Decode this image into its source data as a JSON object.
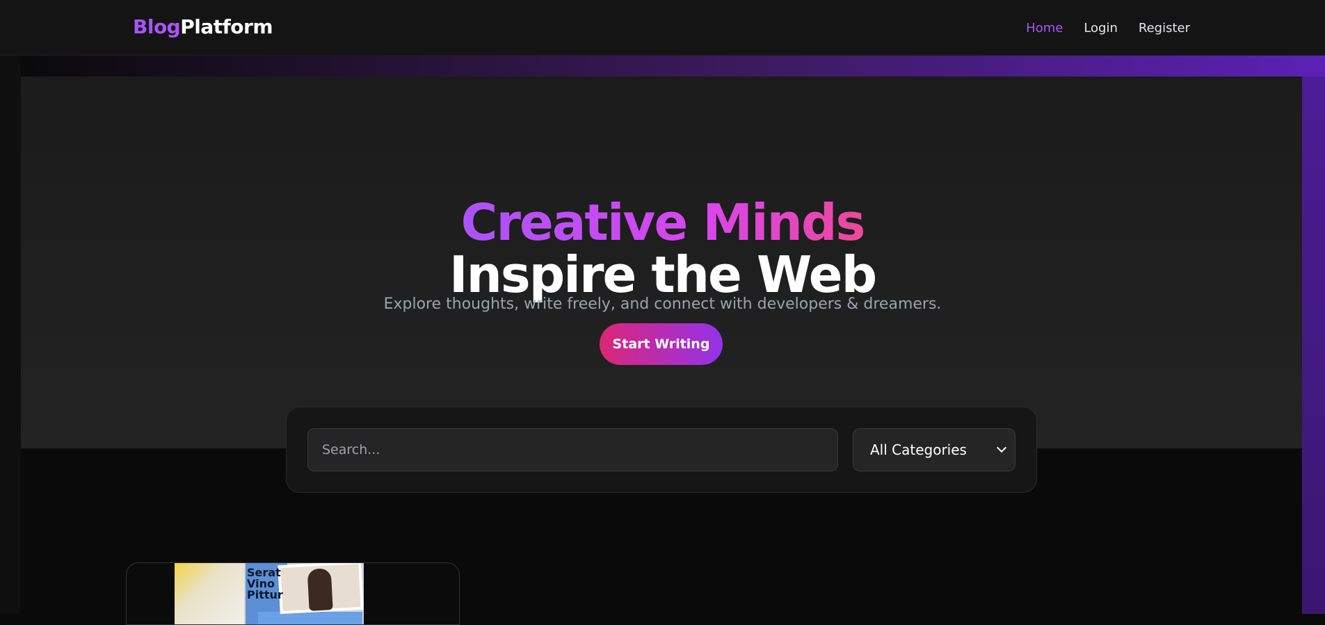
{
  "nav": {
    "brand_part1": "Blog",
    "brand_part2": "Platform",
    "links": [
      {
        "label": "Home",
        "active": true
      },
      {
        "label": "Login",
        "active": false
      },
      {
        "label": "Register",
        "active": false
      }
    ]
  },
  "hero": {
    "title_line1": "Creative Minds",
    "title_line2": "Inspire the Web",
    "subtitle": "Explore thoughts, write freely, and connect with developers & dreamers.",
    "cta_label": "Start Writing"
  },
  "search": {
    "placeholder": "Search...",
    "category_selected": "All Categories"
  },
  "post_card": {
    "image_text": "Serat\nVino\nPittur"
  },
  "colors": {
    "accent_purple": "#a855f7",
    "accent_pink": "#ec4899",
    "background": "#0a0a0a"
  }
}
